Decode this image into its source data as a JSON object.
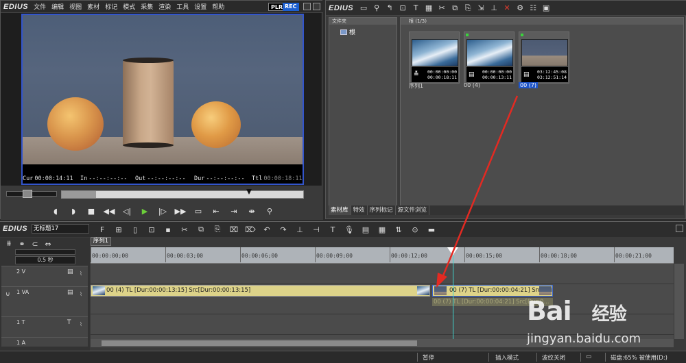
{
  "player": {
    "brand": "EDIUS",
    "menu": [
      "文件",
      "编辑",
      "视图",
      "素材",
      "标记",
      "模式",
      "采集",
      "渲染",
      "工具",
      "设置",
      "帮助"
    ],
    "plr": "PLR",
    "rec": "REC",
    "timecodes": {
      "cur_label": "Cur",
      "cur_value": "00:00:14:11",
      "in_label": "In",
      "in_value": "--:--:--:--",
      "out_label": "Out",
      "out_value": "--:--:--:--",
      "dur_label": "Dur",
      "dur_value": "--:--:--:--",
      "ttl_label": "Ttl",
      "ttl_value": "00:00:18:11"
    }
  },
  "bin": {
    "brand": "EDIUS",
    "folder_header": "文件夹",
    "root": "根",
    "clip_header": "根 (1/3)",
    "clips": [
      {
        "label": "序列1",
        "tc1": "00:00:00:00",
        "tc2": "00:00:18:11",
        "selected": false
      },
      {
        "label": "00 (4)",
        "tc1": "00:00:00:00",
        "tc2": "00:00:13:11",
        "selected": false
      },
      {
        "label": "00 (7)",
        "tc1": "03:12:45:08",
        "tc2": "03:12:51:14",
        "selected": true
      }
    ],
    "tabs": [
      "素材库",
      "特效",
      "序列标记",
      "源文件浏览"
    ]
  },
  "timeline": {
    "brand": "EDIUS",
    "project": "无标题17",
    "zoom": "0.5 秒",
    "sequence_tab": "序列1",
    "ruler": [
      "00:00:00;00",
      "00:00:03;00",
      "00:00:06;00",
      "00:00:09;00",
      "00:00:12;00",
      "00:00:15;00",
      "00:00:18;00",
      "00:00:21;00"
    ],
    "tracks": [
      {
        "name": "2 V"
      },
      {
        "name": "1 VA"
      },
      {
        "name": "1 T"
      },
      {
        "name": "1 A"
      }
    ],
    "clip_a": "00 (4)  TL [Dur:00:00:13:15]  Src[Dur:00:00:13:15]",
    "clip_b": "00 (7)  TL [Dur:00:00:04:21]  Src[Dur:00:0...",
    "audio_ghost": "00 (7)  TL [Dur:00:00:04:21]  Src[Dur:0..."
  },
  "status": {
    "pause": "暂停",
    "insert_mode": "插入模式",
    "ripple_off": "波纹关闭",
    "disk": "磁盘:65% 被使用(D:)"
  },
  "watermark": {
    "logo": "Bai",
    "logo_tail": "经验",
    "url": "jingyan.baidu.com"
  }
}
